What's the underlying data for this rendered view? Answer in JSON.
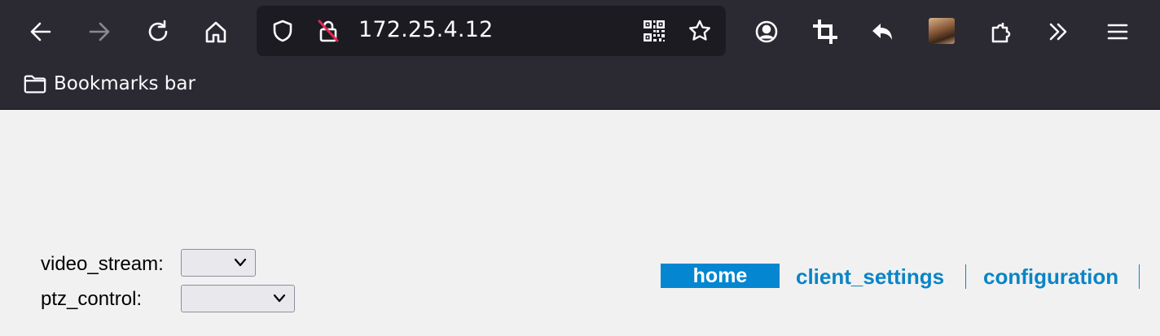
{
  "browser": {
    "url": "172.25.4.12",
    "bookmarks_bar_label": "Bookmarks bar"
  },
  "form": {
    "video_stream_label": "video_stream:",
    "video_stream_value": "",
    "ptz_control_label": "ptz_control:",
    "ptz_control_value": ""
  },
  "nav": {
    "items": [
      {
        "label": "home",
        "active": true
      },
      {
        "label": "client_settings",
        "active": false
      },
      {
        "label": "configuration",
        "active": false
      }
    ]
  },
  "colors": {
    "chrome_bg": "#2b2a33",
    "urlbar_bg": "#1c1b22",
    "page_bg": "#f1f1f1",
    "nav_active_bg": "#0586d0",
    "nav_link": "#0a84c6"
  }
}
